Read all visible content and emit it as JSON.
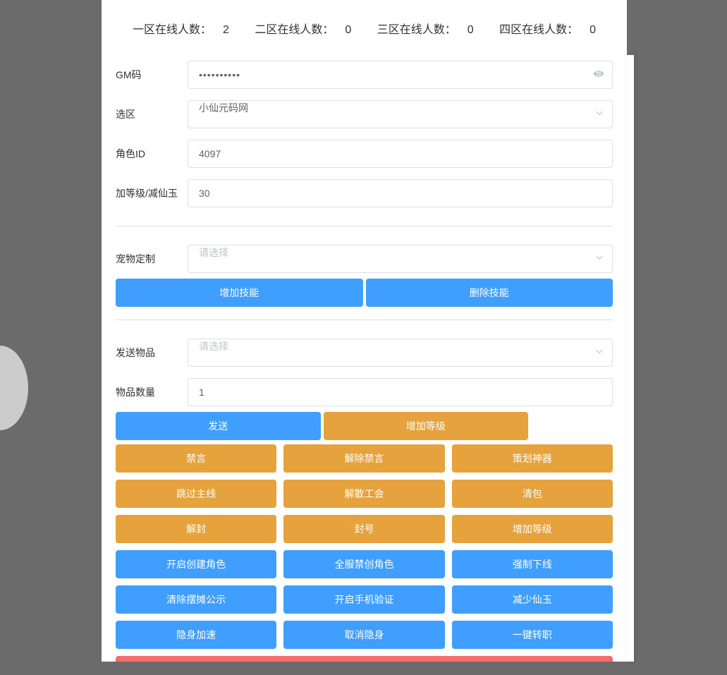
{
  "stats": {
    "zone1_label": "一区在线人数：",
    "zone1_value": "2",
    "zone2_label": "二区在线人数：",
    "zone2_value": "0",
    "zone3_label": "三区在线人数：",
    "zone3_value": "0",
    "zone4_label": "四区在线人数：",
    "zone4_value": "0"
  },
  "form": {
    "gm_code_label": "GM码",
    "gm_code_value": "••••••••••",
    "zone_label": "选区",
    "zone_value": "小仙元码网",
    "role_id_label": "角色ID",
    "role_id_value": "4097",
    "level_label": "加等级/减仙玉",
    "level_value": "30",
    "pet_label": "宠物定制",
    "pet_placeholder": "请选择",
    "send_item_label": "发送物品",
    "send_item_placeholder": "请选择",
    "item_qty_label": "物品数量",
    "item_qty_value": "1"
  },
  "buttons": {
    "add_skill": "增加技能",
    "del_skill": "删除技能",
    "send": "发送",
    "inc_level": "增加等级",
    "mute": "禁言",
    "unmute": "解除禁言",
    "planner_artifact": "策划神器",
    "skip_main": "跳过主线",
    "disband_guild": "解散工会",
    "clear_bag": "清包",
    "unban": "解封",
    "ban": "封号",
    "inc_level2": "增加等级",
    "enable_create_role": "开启创建角色",
    "disable_create_role": "全服禁创角色",
    "force_offline": "强制下线",
    "clear_stall": "清除摆摊公示",
    "enable_phone_verify": "开启手机验证",
    "reduce_jade": "减少仙玉",
    "stealth_boost": "隐身加速",
    "cancel_stealth": "取消隐身",
    "one_click_job": "一键转职"
  }
}
